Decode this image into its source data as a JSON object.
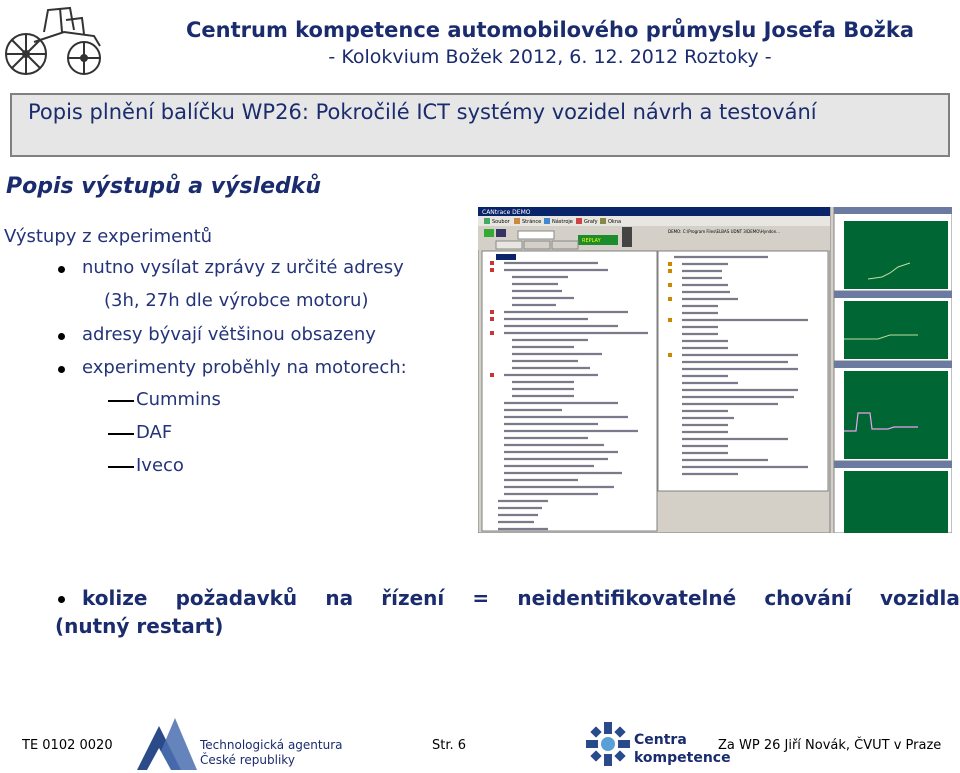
{
  "header": {
    "title": "Centrum kompetence automobilového průmyslu Josefa Božka",
    "subtitle": "- Kolokvium Božek 2012, 6. 12. 2012 Roztoky -"
  },
  "slide": {
    "title": "Popis plnění balíčku WP26: Pokročilé ICT systémy vozidel  návrh a testování"
  },
  "section": {
    "title": "Popis výstupů a výsledků",
    "intro": "Výstupy z experimentů",
    "bullets": [
      "nutno vysílat zprávy z určité adresy",
      "(3h, 27h dle výrobce motoru)",
      "adresy bývají většinou obsazeny",
      "experimenty proběhly na motorech:"
    ],
    "engines": [
      "Cummins",
      "DAF",
      "Iveco"
    ]
  },
  "screenshot": {
    "app_title": "CANtrace DEMO",
    "menu": [
      "Soubor",
      "Stránce",
      "Nástroje",
      "Grafy",
      "Okna"
    ],
    "replay_label": "REPLAY",
    "path": "DEMO: C:\\Program Files\\ELBAS UDNT 3\\DEMO\\Hyndon..."
  },
  "conclusion": {
    "line1_parts": [
      "kolize",
      "požadavků",
      "na",
      "řízení",
      "=",
      "neidentifikovatelné",
      "chování",
      "vozidla"
    ],
    "line2": "(nutný restart)"
  },
  "footer": {
    "code": "TE 0102 0020",
    "agency_line1": "Technologická agentura",
    "agency_line2": "České republiky",
    "page": "Str. 6",
    "centre_line1": "Centra",
    "centre_line2": "kompetence",
    "author": "Za WP 26 Jiří Novák, ČVUT v Praze"
  },
  "colors": {
    "heading_blue": "#1a2c6e",
    "text_blue": "#24347a",
    "title_box_bg": "#e6e6e6",
    "app_titlebar": "#0a246a",
    "plot_green": "#006633"
  }
}
